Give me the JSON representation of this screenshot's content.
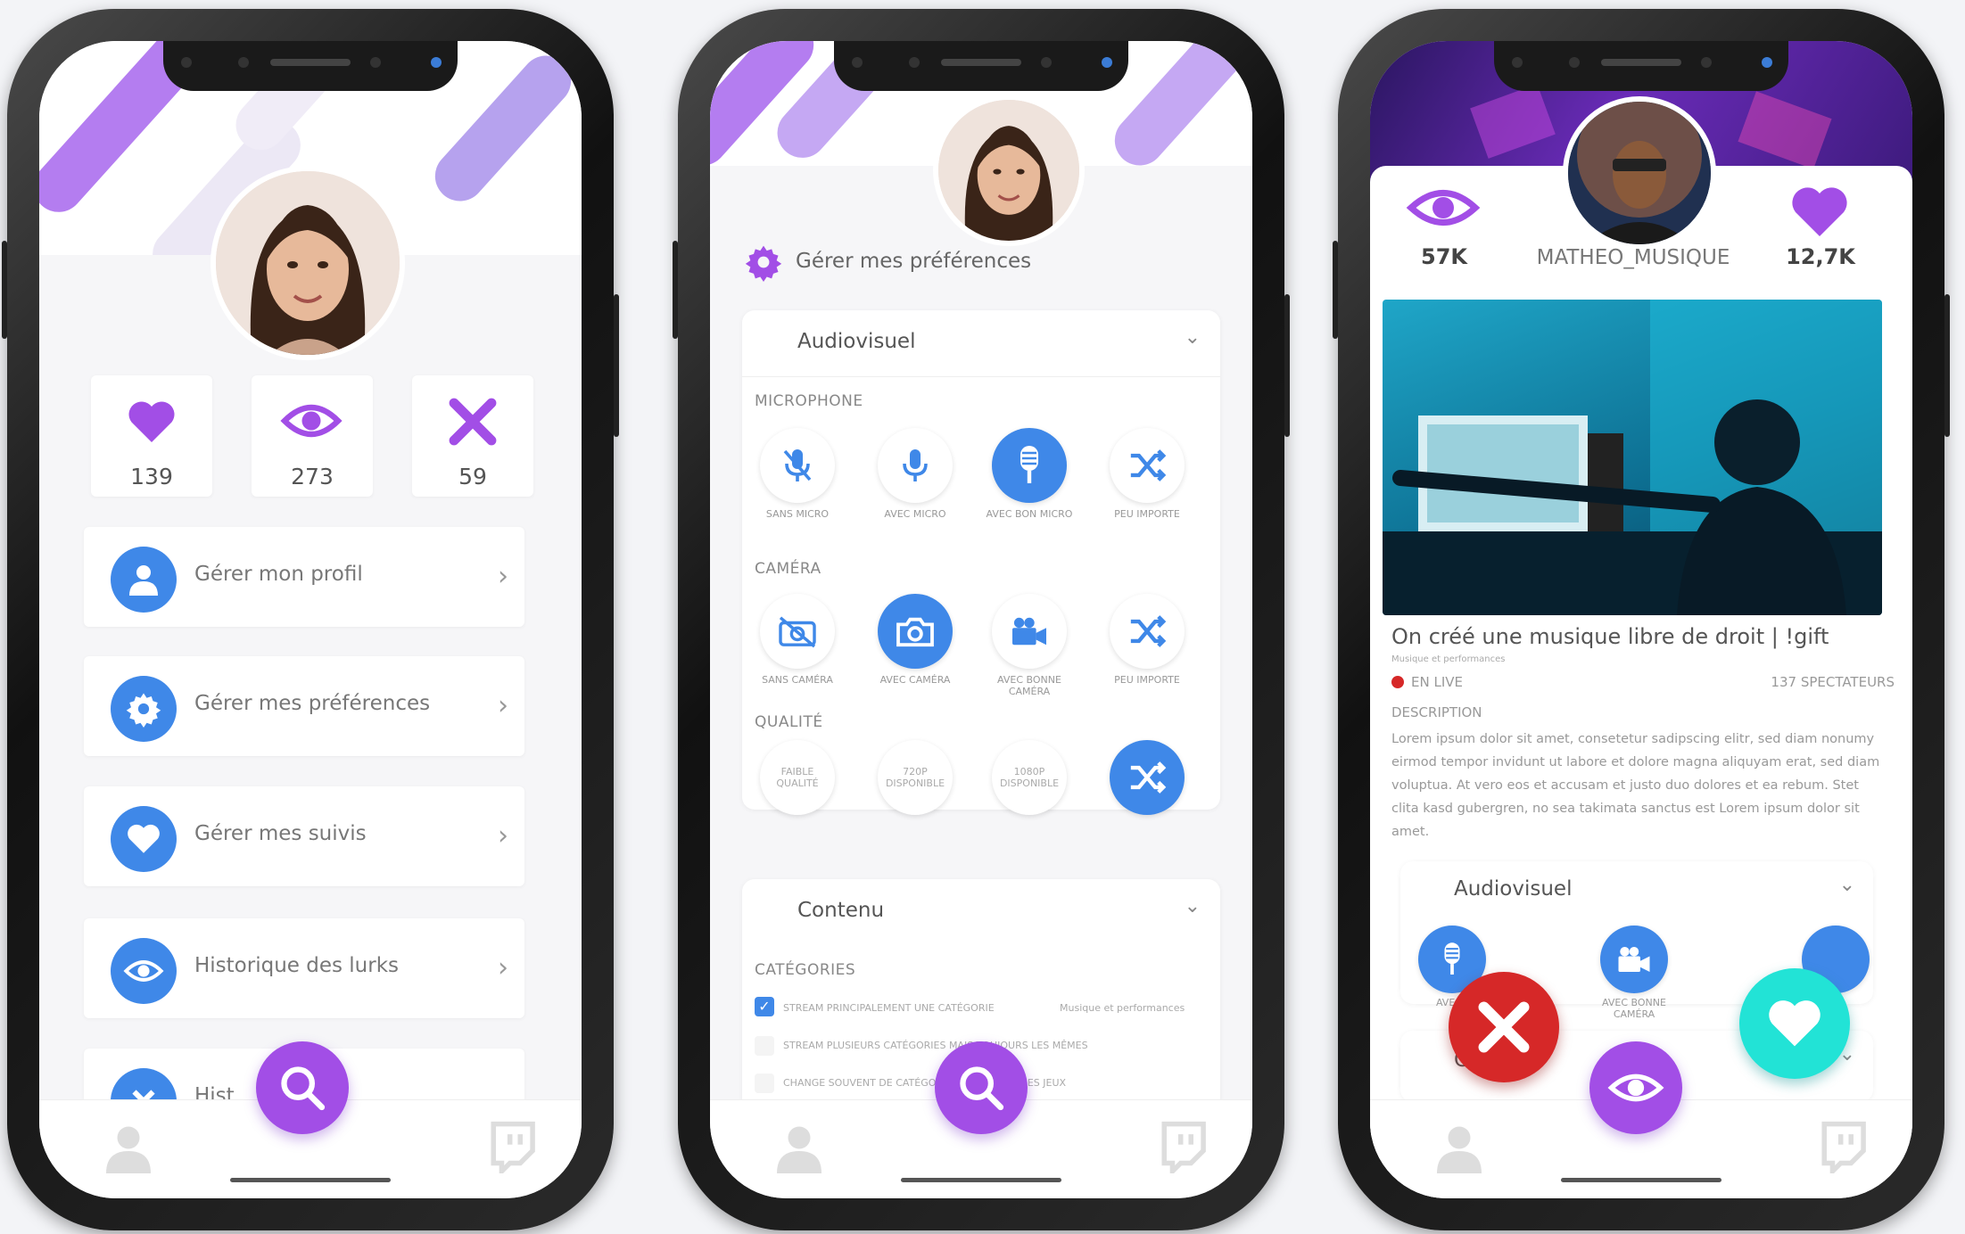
{
  "colors": {
    "purple": "#a24ee6",
    "blue": "#3f88e8",
    "red": "#d62828",
    "cyan": "#22e3d6",
    "bg": "#f6f6f8"
  },
  "phone1": {
    "stats": [
      {
        "icon": "heart-icon",
        "value": "139"
      },
      {
        "icon": "eye-icon",
        "value": "273"
      },
      {
        "icon": "x-icon",
        "value": "59"
      }
    ],
    "menu": [
      {
        "icon": "user-icon",
        "label": "Gérer mon profil"
      },
      {
        "icon": "gear-icon",
        "label": "Gérer mes préférences"
      },
      {
        "icon": "heart-icon",
        "label": "Gérer mes suivis"
      },
      {
        "icon": "eye-icon",
        "label": "Historique des lurks"
      }
    ],
    "partial_label": "Hist"
  },
  "phone2": {
    "title": "Gérer mes préférences",
    "audiovisuel": {
      "header": "Audiovisuel",
      "microphone": {
        "label": "MICROPHONE",
        "options": [
          "SANS MICRO",
          "AVEC MICRO",
          "AVEC BON MICRO",
          "PEU IMPORTE"
        ],
        "selected": 2
      },
      "camera": {
        "label": "CAMÉRA",
        "options": [
          "SANS CAMÉRA",
          "AVEC CAMÉRA",
          "AVEC BONNE CAMÉRA",
          "PEU IMPORTE"
        ],
        "selected": 1
      },
      "qualite": {
        "label": "QUALITÉ",
        "options": [
          "FAIBLE QUALITÉ",
          "720P DISPONIBLE",
          "1080P DISPONIBLE",
          ""
        ],
        "selected": 3
      }
    },
    "contenu": {
      "header": "Contenu",
      "categories_label": "CATÉGORIES",
      "rows": [
        {
          "text": "STREAM PRINCIPALEMENT UNE CATÉGORIE",
          "checked": true,
          "select": "Musique et performances"
        },
        {
          "text": "STREAM PLUSIEURS CATÉGORIES MAIS TOUJOURS LES MÊMES",
          "checked": false
        },
        {
          "text": "CHANGE SOUVENT DE CATÉGORIE / DÉCOUVRE DES JEUX",
          "checked": false
        }
      ]
    }
  },
  "phone3": {
    "viewers_stat": "57K",
    "username": "MATHEO_MUSIQUE",
    "likes_stat": "12,7K",
    "stream_title": "On créé une musique libre de droit | !gift",
    "category": "Musique et performances",
    "live": "EN LIVE",
    "spectators": "137 SPECTATEURS",
    "description_label": "DESCRIPTION",
    "description": "Lorem ipsum dolor sit amet, consetetur sadipscing elitr, sed diam nonumy eirmod tempor invidunt ut labore et dolore magna aliquyam erat, sed diam voluptua. At vero eos et accusam et justo duo dolores et ea rebum. Stet clita kasd gubergren, no sea takimata sanctus est Lorem ipsum dolor sit amet.",
    "audiovisuel_header": "Audiovisuel",
    "av_labels": [
      "AVEC B",
      "AVEC BONNE CAMÉRA"
    ],
    "partial_label": "C"
  }
}
